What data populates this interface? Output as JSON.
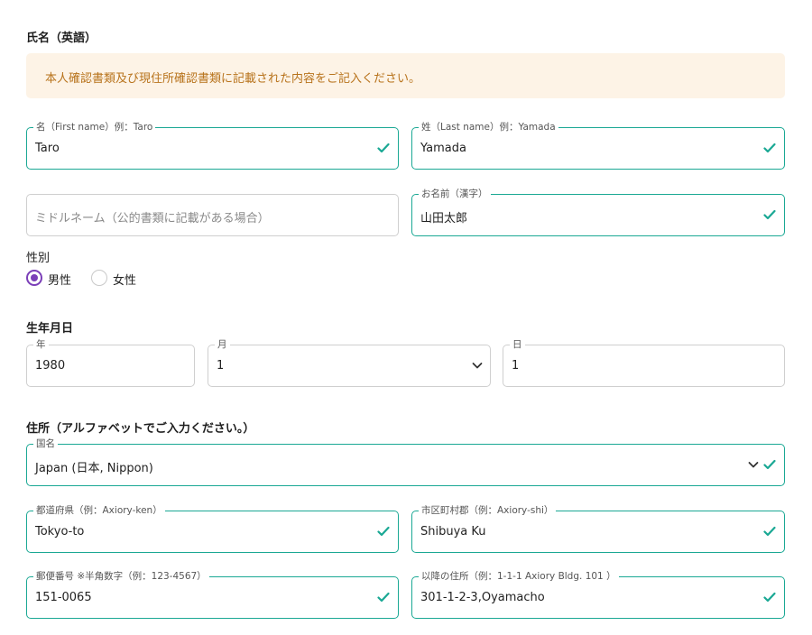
{
  "name_section": {
    "title": "氏名（英語）",
    "notice": "本人確認書類及び現住所確認書類に記載された内容をご記入ください。",
    "first_name": {
      "label": "名（First name）例：Taro",
      "value": "Taro"
    },
    "last_name": {
      "label": "姓（Last name）例：Yamada",
      "value": "Yamada"
    },
    "middle_name": {
      "placeholder": "ミドルネーム（公的書類に記載がある場合）",
      "value": ""
    },
    "kanji_name": {
      "label": "お名前（漢字）",
      "value": "山田太郎"
    }
  },
  "gender": {
    "label": "性別",
    "options": [
      {
        "label": "男性",
        "selected": true
      },
      {
        "label": "女性",
        "selected": false
      }
    ]
  },
  "birthdate": {
    "title": "生年月日",
    "year": {
      "label": "年",
      "value": "1980"
    },
    "month": {
      "label": "月",
      "value": "1"
    },
    "day": {
      "label": "日",
      "value": "1"
    }
  },
  "address": {
    "title": "住所（アルファベットでご入力ください。）",
    "country": {
      "label": "国名",
      "value": "Japan (日本, Nippon)"
    },
    "prefecture": {
      "label": "都道府県（例：Axiory-ken）",
      "value": "Tokyo-to"
    },
    "city": {
      "label": "市区町村郡（例：Axiory-shi）",
      "value": "Shibuya Ku"
    },
    "postal": {
      "label": "郵便番号 ※半角数字（例：123-4567）",
      "value": "151-0065"
    },
    "street": {
      "label": "以降の住所（例：1-1-1 Axiory Bldg. 101 ）",
      "value": "301-1-2-3,Oyamacho"
    }
  },
  "icons": {
    "valid": "check-icon",
    "dropdown": "chevron-down-icon"
  },
  "colors": {
    "valid_border": "#1aa894",
    "check": "#1aa894",
    "notice_bg": "#fdf3e6",
    "notice_text": "#b8731c",
    "radio_selected": "#7b3fb8"
  }
}
